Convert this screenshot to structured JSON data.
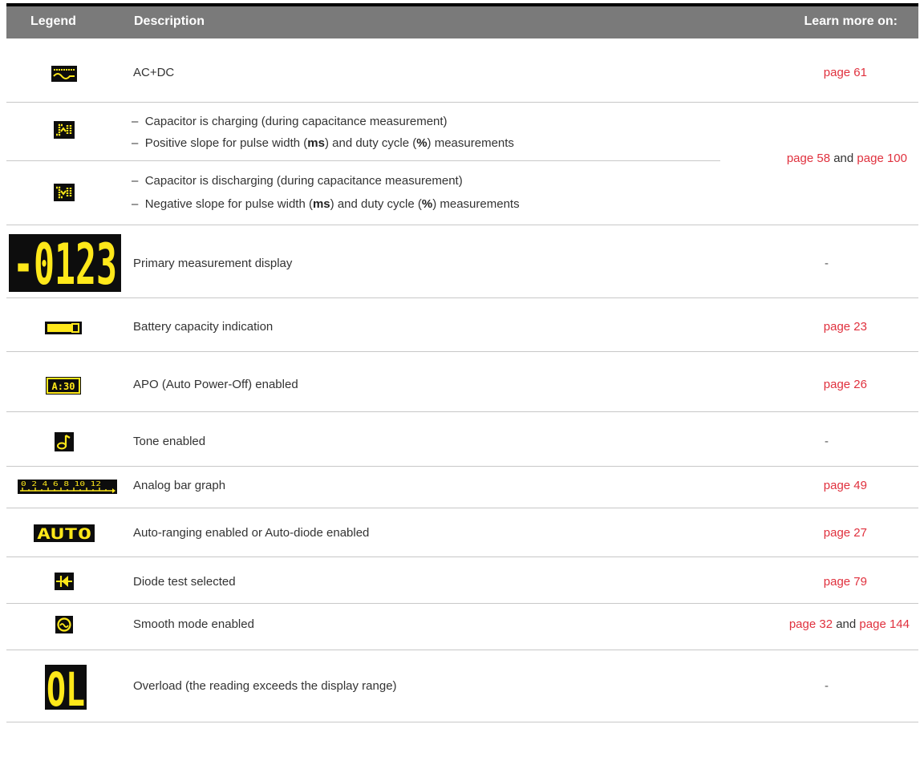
{
  "header": {
    "legend": "Legend",
    "description": "Description",
    "learn_more": "Learn more on:"
  },
  "rows": [
    {
      "icon": "ac-dc-icon",
      "description": "AC+DC",
      "learn": "page 61"
    },
    {
      "icon": "positive-slope-icon",
      "lines": [
        "Capacitor is charging (during capacitance measurement)",
        "Positive slope for pulse width (",
        "ms",
        ") and duty cycle (",
        "%",
        ") measurements"
      ]
    },
    {
      "icon": "negative-slope-icon",
      "lines": [
        "Capacitor is discharging (during capacitance measurement)",
        "Negative slope for pulse width (",
        "ms",
        ") and duty cycle (",
        "%",
        ") measurements"
      ]
    },
    {
      "icon": "primary-display-icon",
      "description": "Primary measurement display",
      "learn": "-",
      "digits": "-0123"
    },
    {
      "icon": "battery-icon",
      "description": "Battery capacity indication",
      "learn": "page 23"
    },
    {
      "icon": "apo-icon",
      "description": "APO (Auto Power-Off) enabled",
      "learn": "page 26"
    },
    {
      "icon": "tone-icon",
      "description": "Tone enabled",
      "learn": "-"
    },
    {
      "icon": "bar-graph-icon",
      "description": "Analog bar graph",
      "learn": "page 49",
      "scale": "0 2 4 6 8 10 12"
    },
    {
      "icon": "auto-icon",
      "description": "Auto-ranging enabled or Auto-diode enabled",
      "learn": "page 27",
      "label": "AUTO"
    },
    {
      "icon": "diode-icon",
      "description": "Diode test selected",
      "learn": "page 79"
    },
    {
      "icon": "smooth-icon",
      "description": "Smooth mode enabled",
      "learn_a": "page 32",
      "learn_and": " and ",
      "learn_b": "page 144"
    },
    {
      "icon": "overload-icon",
      "description": "Overload (the reading exceeds the display range)",
      "learn": "-",
      "label": "OL"
    }
  ],
  "slope_learn": {
    "a": "page 58",
    "and": " and ",
    "b": "page 100"
  },
  "bullet": "–",
  "colors": {
    "header_bg": "#7a7a7a",
    "link": "#e0313e",
    "lcd_fg": "#ffe81a",
    "lcd_bg": "#0d0d0d"
  }
}
